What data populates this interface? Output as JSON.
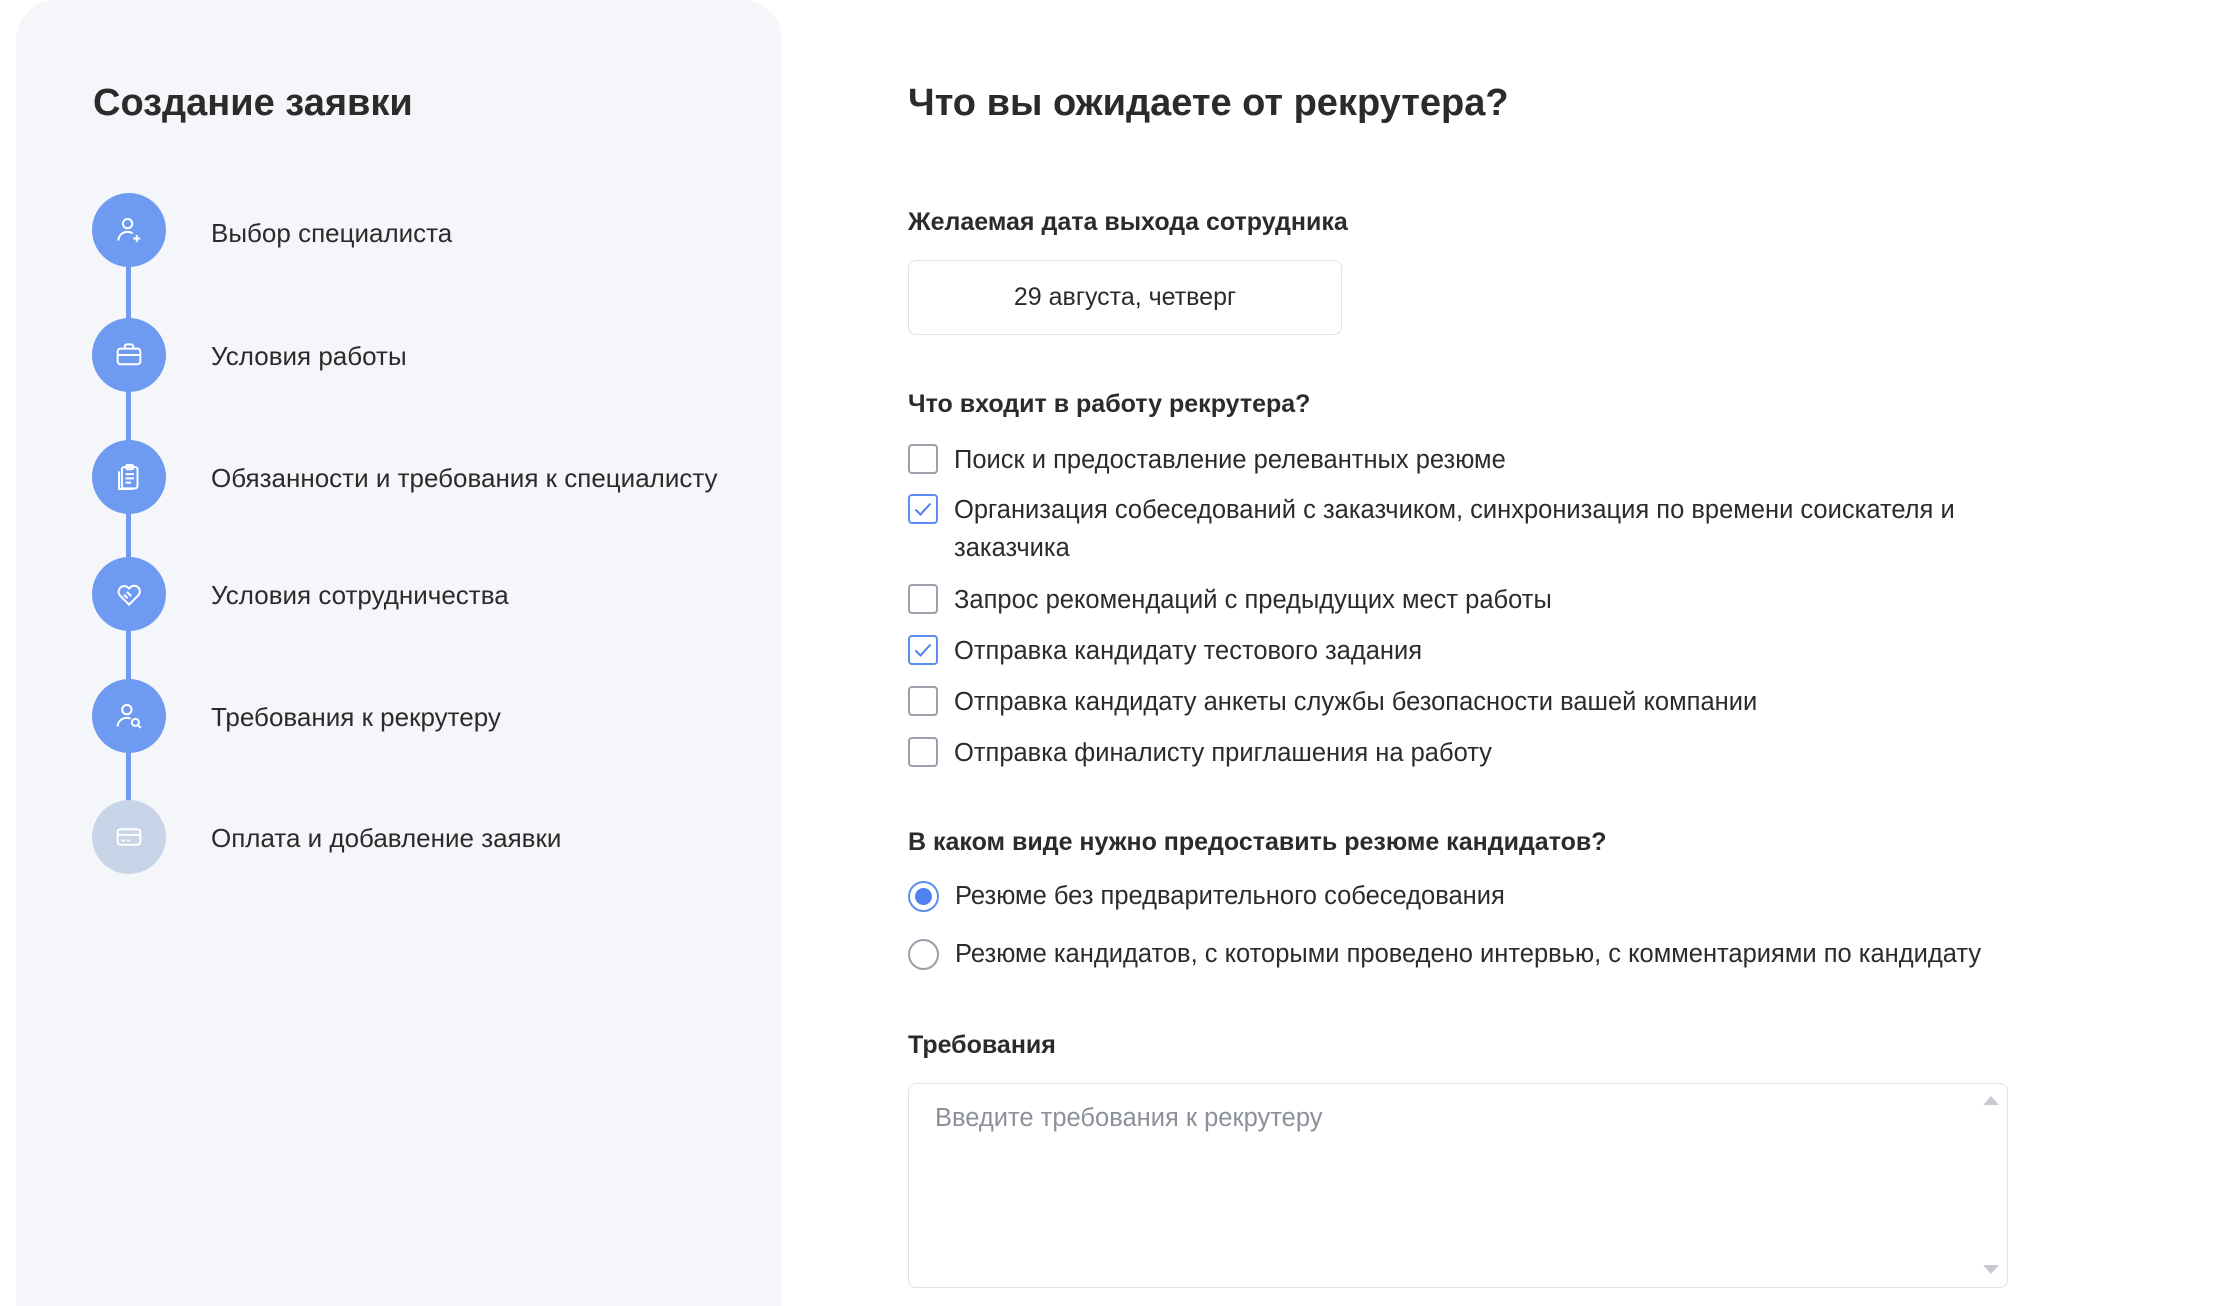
{
  "sidebar": {
    "title": "Создание заявки",
    "steps": [
      {
        "label": "Выбор специалиста",
        "icon": "user-plus-icon",
        "active": true
      },
      {
        "label": "Условия работы",
        "icon": "briefcase-icon",
        "active": true
      },
      {
        "label": "Обязанности и требования к специалисту",
        "icon": "clipboard-icon",
        "active": true
      },
      {
        "label": "Условия сотрудничества",
        "icon": "handshake-heart-icon",
        "active": true
      },
      {
        "label": "Требования к рекрутеру",
        "icon": "user-search-icon",
        "active": true
      },
      {
        "label": "Оплата и добавление заявки",
        "icon": "credit-card-icon",
        "active": false
      }
    ]
  },
  "main": {
    "title": "Что вы ожидаете от рекрутера?",
    "date_section": {
      "label": "Желаемая дата выхода сотрудника",
      "value": "29 августа, четверг"
    },
    "tasks_section": {
      "label": "Что входит в работу рекрутера?",
      "options": [
        {
          "label": "Поиск и предоставление релевантных резюме",
          "checked": false
        },
        {
          "label": "Организация собеседований с заказчиком, синхронизация по времени соискателя и заказчика",
          "checked": true
        },
        {
          "label": "Запрос рекомендаций с предыдущих мест работы",
          "checked": false
        },
        {
          "label": "Отправка кандидату тестового задания",
          "checked": true
        },
        {
          "label": "Отправка кандидату анкеты службы безопасности вашей компании",
          "checked": false
        },
        {
          "label": "Отправка финалисту приглашения на работу",
          "checked": false
        }
      ]
    },
    "resume_section": {
      "label": "В каком виде нужно предоставить резюме кандидатов?",
      "options": [
        {
          "label": "Резюме без предварительного собеседования",
          "selected": true
        },
        {
          "label": "Резюме кандидатов, с которыми проведено интервью, с комментариями по кандидату",
          "selected": false
        }
      ]
    },
    "requirements_section": {
      "label": "Требования",
      "placeholder": "Введите требования к рекрутеру",
      "value": ""
    }
  },
  "colors": {
    "accent": "#6e9bf1",
    "inactive_step": "#c8d4e8",
    "sidebar_bg": "#f5f6fa",
    "text": "#2b2b2b"
  }
}
